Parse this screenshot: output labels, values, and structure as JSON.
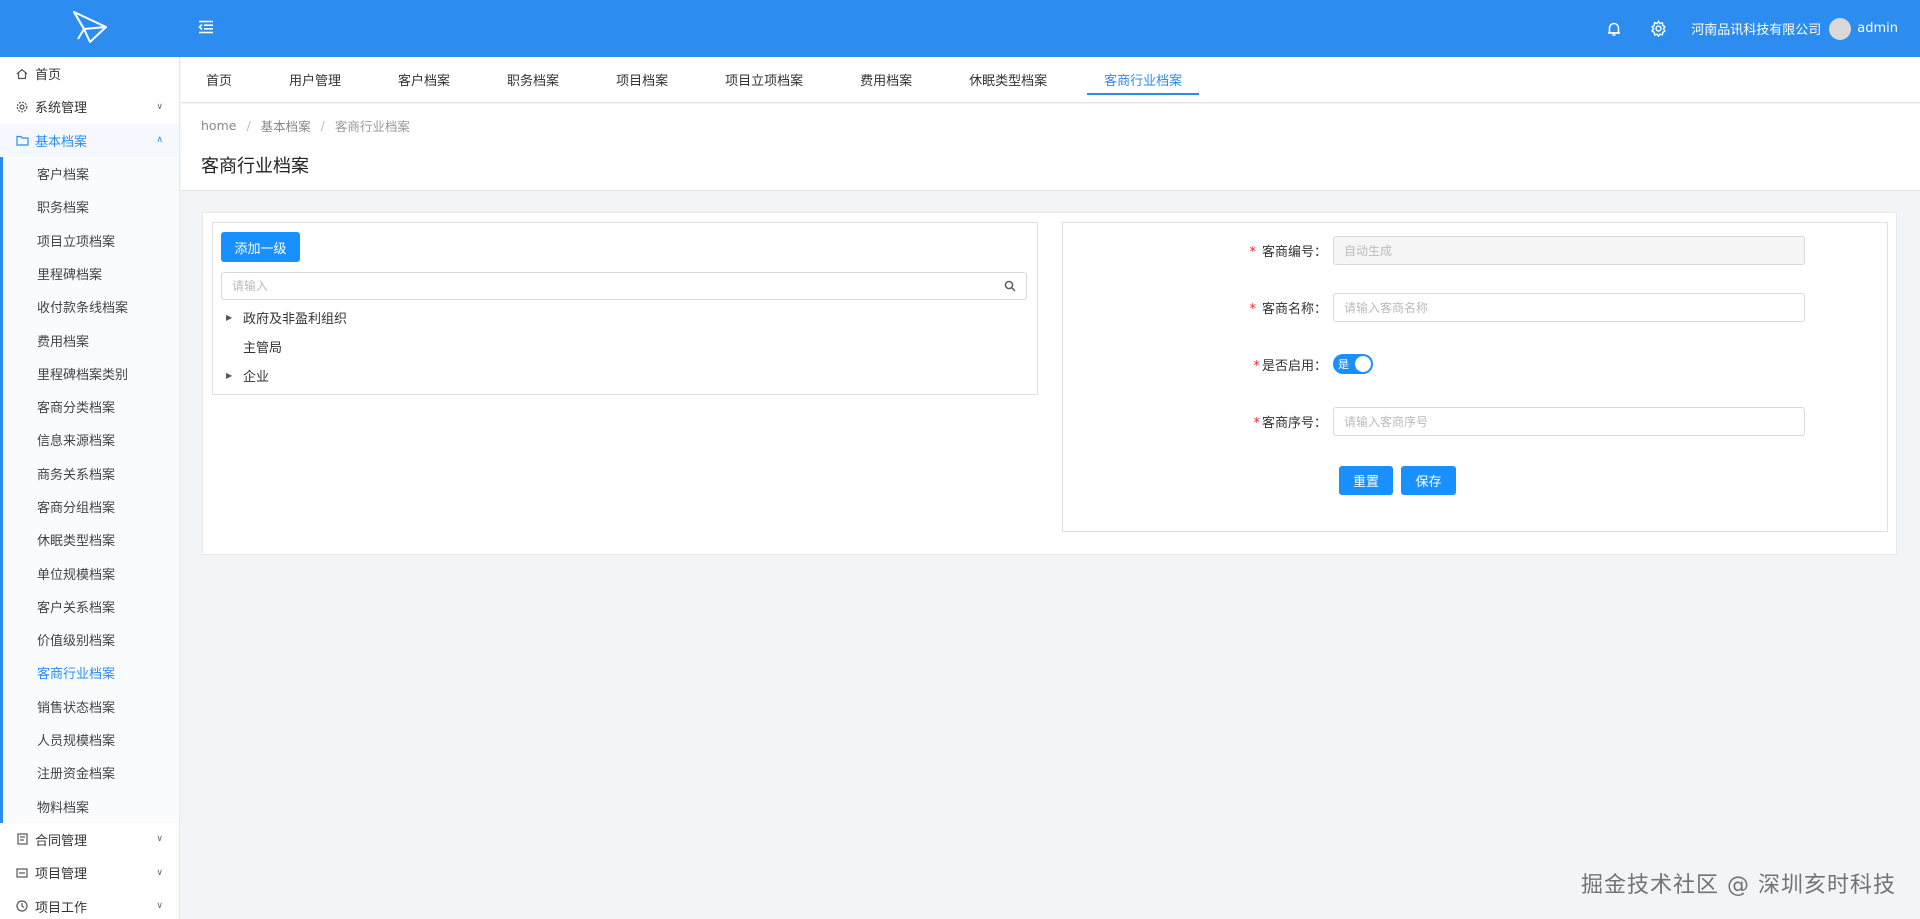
{
  "header": {
    "company": "河南品讯科技有限公司",
    "username": "admin",
    "brand_color": "#2d8cf0",
    "icons": [
      "logo-icon",
      "menu-fold-icon",
      "bell-icon",
      "gear-icon"
    ]
  },
  "sidebar": {
    "items_top": [
      {
        "label": "首页",
        "icon": "home-icon"
      },
      {
        "label": "系统管理",
        "icon": "gear-icon"
      },
      {
        "label": "基本档案",
        "icon": "folder-icon"
      }
    ],
    "sub_items": [
      "客户档案",
      "职务档案",
      "项目立项档案",
      "里程碑档案",
      "收付款条线档案",
      "费用档案",
      "里程碑档案类别",
      "客商分类档案",
      "信息来源档案",
      "商务关系档案",
      "客商分组档案",
      "休眠类型档案",
      "单位规模档案",
      "客户关系档案",
      "价值级别档案",
      "客商行业档案",
      "销售状态档案",
      "人员规模档案",
      "注册资金档案",
      "物料档案"
    ],
    "items_bottom": [
      {
        "label": "合同管理",
        "icon": "contract-icon"
      },
      {
        "label": "项目管理",
        "icon": "project-icon"
      },
      {
        "label": "项目工作",
        "icon": "clock-icon"
      }
    ]
  },
  "tabs": [
    "首页",
    "用户管理",
    "客户档案",
    "职务档案",
    "项目档案",
    "项目立项档案",
    "费用档案",
    "休眠类型档案",
    "客商行业档案"
  ],
  "breadcrumb": [
    "home",
    "基本档案",
    "客商行业档案"
  ],
  "page_title": "客商行业档案",
  "left_panel": {
    "add_button": "添加一级",
    "search_placeholder": "请输入",
    "tree": [
      {
        "label": "政府及非盈利组织",
        "expandable": true
      },
      {
        "label": "主管局",
        "expandable": false
      },
      {
        "label": "企业",
        "expandable": true
      }
    ]
  },
  "form": {
    "code_label": "客商编号：",
    "code_placeholder": "自动生成",
    "name_label": "客商名称：",
    "name_placeholder": "请输入客商名称",
    "enabled_label": "是否启用：",
    "enabled_value": "是",
    "seq_label": "客商序号：",
    "seq_placeholder": "请输入客商序号",
    "reset_button": "重置",
    "save_button": "保存"
  },
  "watermark": "掘金技术社区 @ 深圳亥时科技"
}
